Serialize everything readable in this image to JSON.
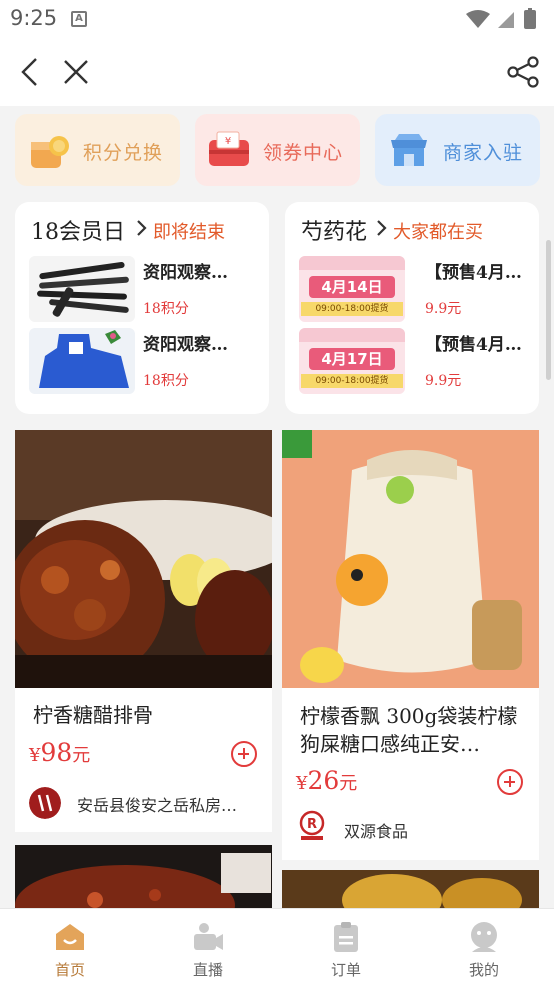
{
  "status_bar": {
    "time": "9:25"
  },
  "shortcuts": [
    {
      "label": "积分兑换",
      "color": "#e6a35a"
    },
    {
      "label": "领券中心",
      "color": "#e86a5a"
    },
    {
      "label": "商家入驻",
      "color": "#4f8fd9"
    }
  ],
  "promos": [
    {
      "title": "18会员日",
      "subtitle": "即将结束",
      "items": [
        {
          "name": "资阳观察…",
          "price": "18积分"
        },
        {
          "name": "资阳观察…",
          "price": "18积分"
        }
      ]
    },
    {
      "title": "芍药花",
      "subtitle": "大家都在买",
      "items": [
        {
          "name": "【预售4月…",
          "price": "9.9元",
          "poster_date": "4月14日",
          "poster_time": "09:00-18:00提货"
        },
        {
          "name": "【预售4月…",
          "price": "9.9元",
          "poster_date": "4月17日",
          "poster_time": "09:00-18:00提货"
        }
      ]
    }
  ],
  "products": [
    {
      "title": "柠香糖醋排骨",
      "currency": "¥",
      "price": "98",
      "unit": "元",
      "shop": "安岳县俊安之岳私房…"
    },
    {
      "title": "柠檬香飘 300g袋装柠檬狗屎糖口感纯正安…",
      "currency": "¥",
      "price": "26",
      "unit": "元",
      "shop": "双源食品"
    }
  ],
  "tabs": [
    {
      "label": "首页",
      "icon": "home-icon",
      "active": true
    },
    {
      "label": "直播",
      "icon": "live-icon",
      "active": false
    },
    {
      "label": "订单",
      "icon": "order-icon",
      "active": false
    },
    {
      "label": "我的",
      "icon": "profile-icon",
      "active": false
    }
  ],
  "colors": {
    "accent": "#e23b3b",
    "tab_active": "#b77b3a",
    "subtitle": "#e25a2a"
  }
}
